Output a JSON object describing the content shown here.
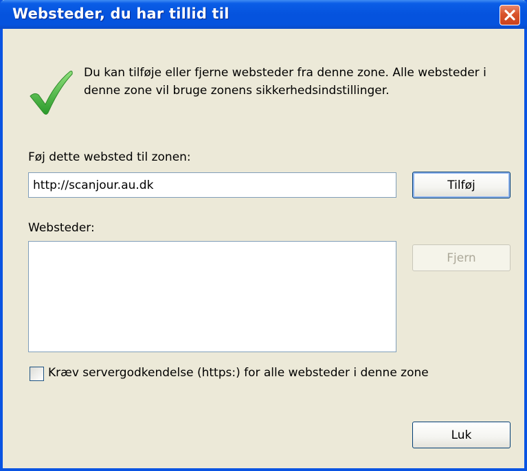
{
  "window": {
    "title": "Websteder, du har tillid til"
  },
  "description": "Du kan tilføje eller fjerne websteder fra denne zone. Alle websteder i denne zone vil bruge zonens sikkerhedsindstillinger.",
  "add_section": {
    "label": "Føj dette websted til zonen:",
    "input_value": "http://scanjour.au.dk",
    "add_button": "Tilføj"
  },
  "sites_section": {
    "label": "Websteder:",
    "items": [],
    "remove_button": "Fjern"
  },
  "require_https": {
    "label": "Kræv servergodkendelse (https:) for alle websteder i denne zone",
    "checked": false
  },
  "close_button": "Luk",
  "icons": {
    "status": "checkmark-icon",
    "close": "close-x-icon"
  },
  "colors": {
    "titlebar": "#0553de",
    "close": "#d9532b",
    "dialog_bg": "#ece9d8",
    "check_green": "#3fb83a"
  }
}
